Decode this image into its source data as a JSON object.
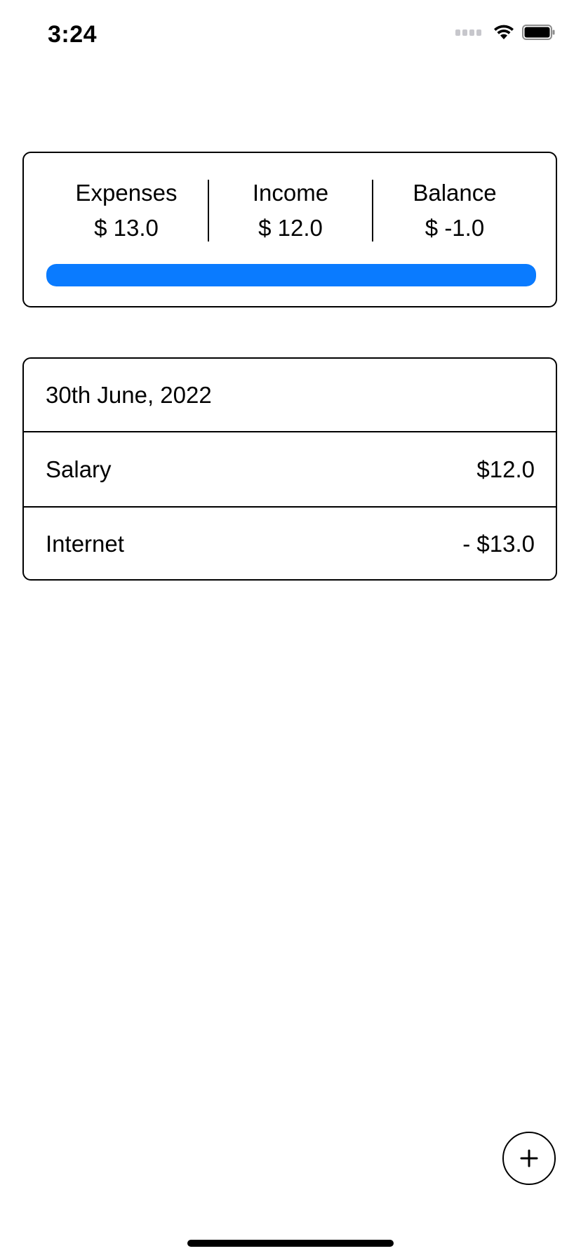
{
  "status_bar": {
    "time": "3:24",
    "icons": [
      "cellular-signal-icon",
      "wifi-icon",
      "battery-icon"
    ]
  },
  "summary": {
    "expenses": {
      "label": "Expenses",
      "value": "$ 13.0"
    },
    "income": {
      "label": "Income",
      "value": "$ 12.0"
    },
    "balance": {
      "label": "Balance",
      "value": "$ -1.0"
    },
    "progress_fraction": 1.0,
    "progress_color": "#0a7bff"
  },
  "transactions": {
    "date": "30th June, 2022",
    "items": [
      {
        "name": "Salary",
        "amount": "$12.0"
      },
      {
        "name": "Internet",
        "amount": "- $13.0"
      }
    ]
  },
  "add_button": {
    "icon": "plus-icon"
  }
}
